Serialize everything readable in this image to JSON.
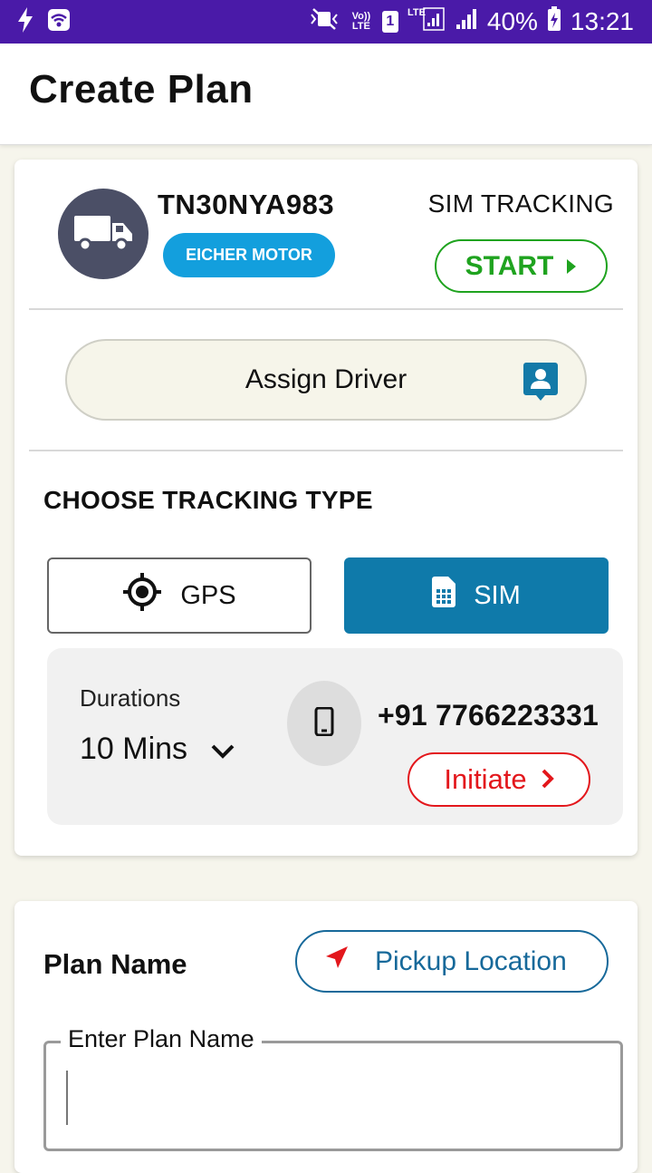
{
  "status_bar": {
    "volte": "Vo)) LTE",
    "sim_slot": "1",
    "lte": "LTE",
    "battery": "40%",
    "time": "13:21"
  },
  "app_bar": {
    "title": "Create Plan"
  },
  "vehicle": {
    "number": "TN30NYA983",
    "brand": "EICHER MOTOR",
    "tracking_label": "SIM TRACKING",
    "start_label": "START"
  },
  "driver": {
    "assign_label": "Assign Driver"
  },
  "tracking": {
    "heading": "CHOOSE TRACKING TYPE",
    "gps_label": "GPS",
    "sim_label": "SIM",
    "selected": "SIM",
    "durations_label": "Durations",
    "duration_value": "10 Mins",
    "phone_number": "+91 7766223331",
    "initiate_label": "Initiate"
  },
  "plan": {
    "name_label": "Plan Name",
    "pickup_label": "Pickup Location",
    "field_label": "Enter Plan Name",
    "field_value": ""
  },
  "colors": {
    "status_bar": "#4a1aa8",
    "brand_badge": "#139fdd",
    "start_green": "#1fa31f",
    "sim_selected": "#0f7aaa",
    "initiate_red": "#e3171c",
    "pickup_blue": "#17699a"
  }
}
